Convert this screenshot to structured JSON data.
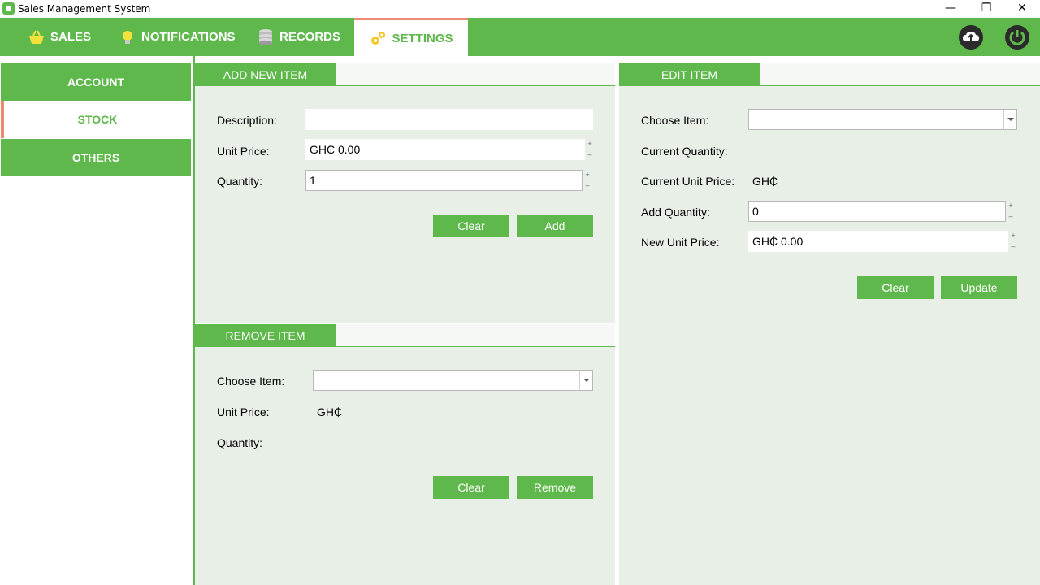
{
  "window": {
    "title": "Sales Management System",
    "minimize": "—",
    "restore": "❐",
    "close": "✕"
  },
  "nav": {
    "tabs": [
      {
        "label": "SALES",
        "icon": "basket-icon"
      },
      {
        "label": "NOTIFICATIONS",
        "icon": "lightbulb-icon"
      },
      {
        "label": "RECORDS",
        "icon": "database-icon"
      },
      {
        "label": "SETTINGS",
        "icon": "gears-icon",
        "active": true
      }
    ],
    "actions": [
      {
        "icon": "cloud-upload-icon"
      },
      {
        "icon": "power-icon"
      }
    ]
  },
  "sidebar": {
    "items": [
      {
        "label": "ACCOUNT"
      },
      {
        "label": "STOCK",
        "active": true
      },
      {
        "label": "OTHERS"
      }
    ]
  },
  "add_item": {
    "title": "ADD NEW ITEM",
    "description_label": "Description:",
    "description_value": "",
    "unit_price_label": "Unit Price:",
    "unit_price_value": "GH₵  0.00",
    "quantity_label": "Quantity:",
    "quantity_value": "1",
    "clear_label": "Clear",
    "add_label": "Add"
  },
  "remove_item": {
    "title": "REMOVE ITEM",
    "choose_label": "Choose Item:",
    "choose_value": "",
    "unit_price_label": "Unit Price:",
    "unit_price_value": "GH₵",
    "quantity_label": "Quantity:",
    "quantity_value": "",
    "clear_label": "Clear",
    "remove_label": "Remove"
  },
  "edit_item": {
    "title": "EDIT ITEM",
    "choose_label": "Choose Item:",
    "choose_value": "",
    "current_quantity_label": "Current Quantity:",
    "current_quantity_value": "",
    "current_price_label": "Current Unit Price:",
    "current_price_value": "GH₵",
    "add_quantity_label": "Add Quantity:",
    "add_quantity_value": "0",
    "new_price_label": "New Unit Price:",
    "new_price_value": "GH₵  0.00",
    "clear_label": "Clear",
    "update_label": "Update"
  },
  "colors": {
    "accent": "#5fb84b",
    "highlight": "#ef8a6f",
    "panel_bg": "#e7efe7"
  }
}
